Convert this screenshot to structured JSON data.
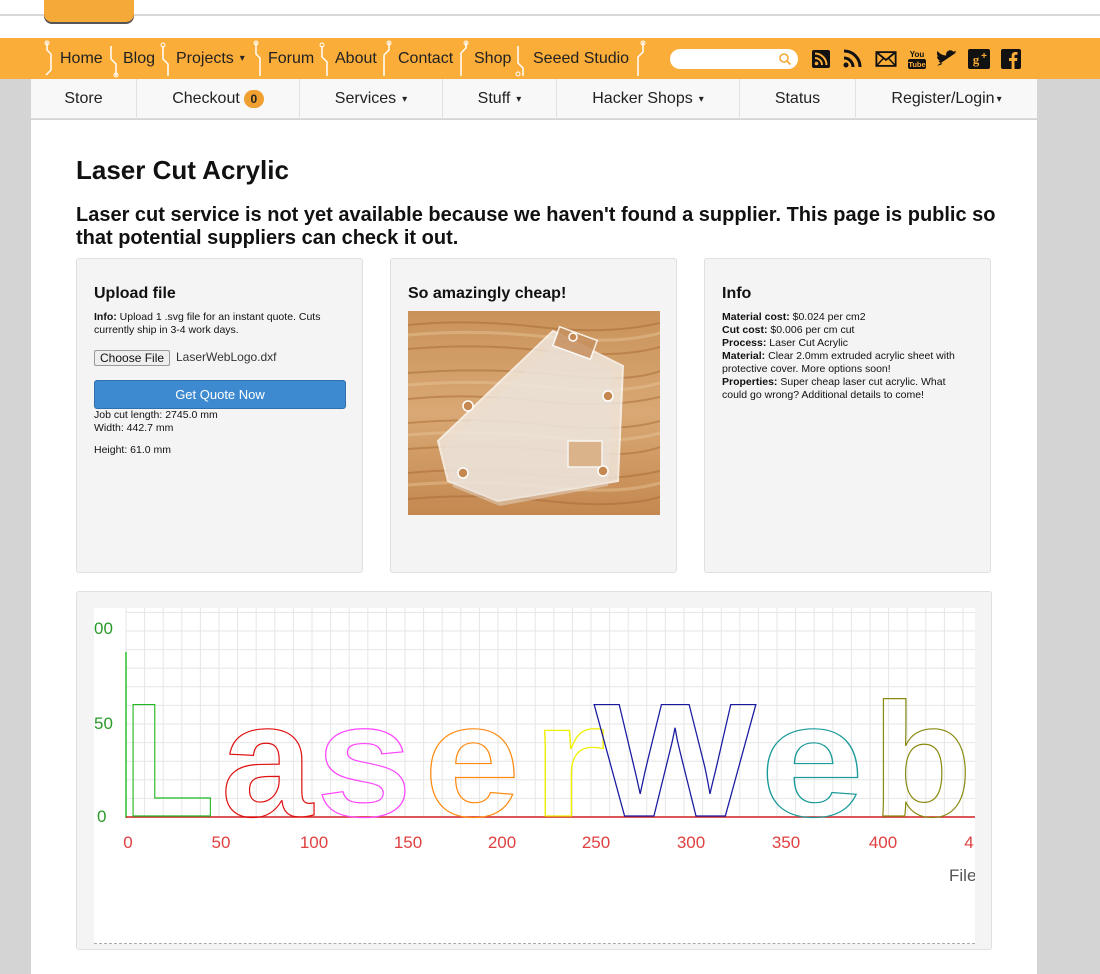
{
  "nav": {
    "items": [
      {
        "label": "Home"
      },
      {
        "label": "Blog"
      },
      {
        "label": "Projects",
        "caret": "▾"
      },
      {
        "label": "Forum"
      },
      {
        "label": "About"
      },
      {
        "label": "Contact"
      },
      {
        "label": "Shop"
      },
      {
        "label": "Seeed Studio"
      }
    ],
    "search_placeholder": "",
    "social_icons": [
      "rss-square-icon",
      "rss-icon",
      "mail-icon",
      "youtube-icon",
      "twitter-icon",
      "google-plus-icon",
      "facebook-icon"
    ]
  },
  "subnav": {
    "items": [
      {
        "label": "Store"
      },
      {
        "label": "Checkout",
        "badge": "0"
      },
      {
        "label": "Services",
        "caret": "▾"
      },
      {
        "label": "Stuff",
        "caret": "▾"
      },
      {
        "label": "Hacker Shops",
        "caret": "▾"
      },
      {
        "label": "Status"
      },
      {
        "label": "Register/Login",
        "caret": "▾"
      }
    ]
  },
  "page": {
    "title": "Laser Cut Acrylic",
    "notice": "Laser cut service is not yet available because we haven't found a supplier. This page is public so that potential suppliers can check it out."
  },
  "upload": {
    "heading": "Upload file",
    "info_label": "Info:",
    "info_text": "Upload 1 .svg file for an instant quote. Cuts currently ship in 3-4 work days.",
    "choose_file_label": "Choose File",
    "file_name": "LaserWebLogo.dxf",
    "quote_button": "Get Quote Now ",
    "job_cut_length": "Job cut length: 2745.0 mm",
    "width": "Width: 442.7 mm",
    "height": "Height: 61.0 mm"
  },
  "cheap": {
    "heading": "So amazingly cheap!"
  },
  "info": {
    "heading": "Info",
    "rows": [
      {
        "label": "Material cost:",
        "value": " $0.024 per cm2"
      },
      {
        "label": "Cut cost:",
        "value": " $0.006 per cm cut"
      },
      {
        "label": "Process:",
        "value": " Laser Cut Acrylic"
      },
      {
        "label": "Material:",
        "value": " Clear 2.0mm extruded acrylic sheet with protective cover. More options soon!"
      },
      {
        "label": "Properties:",
        "value": " Super cheap laser cut acrylic. What could go wrong? Additional details to come!"
      }
    ]
  },
  "preview": {
    "y_labels": [
      "00",
      "50",
      "0"
    ],
    "x_labels": [
      "0",
      "50",
      "100",
      "150",
      "200",
      "250",
      "300",
      "350",
      "400",
      "4"
    ],
    "corner_label": "File",
    "letters": [
      {
        "char": "L",
        "color": "#22b822"
      },
      {
        "char": "a",
        "color": "#e01010"
      },
      {
        "char": "s",
        "color": "#ff44ff"
      },
      {
        "char": "e",
        "color": "#ff8a10"
      },
      {
        "char": "r",
        "color": "#f0f000"
      },
      {
        "char": "W",
        "color": "#1a1aa0"
      },
      {
        "char": "e",
        "color": "#1a9a9a"
      },
      {
        "char": "b",
        "color": "#8a8a10"
      }
    ],
    "inner_colors": {
      "a": "#1a1ae0",
      "e1": "#1a8a1a",
      "b": "#222222"
    },
    "axis_label_color": "#e04040",
    "y_label_color": "#2a9a2a"
  }
}
